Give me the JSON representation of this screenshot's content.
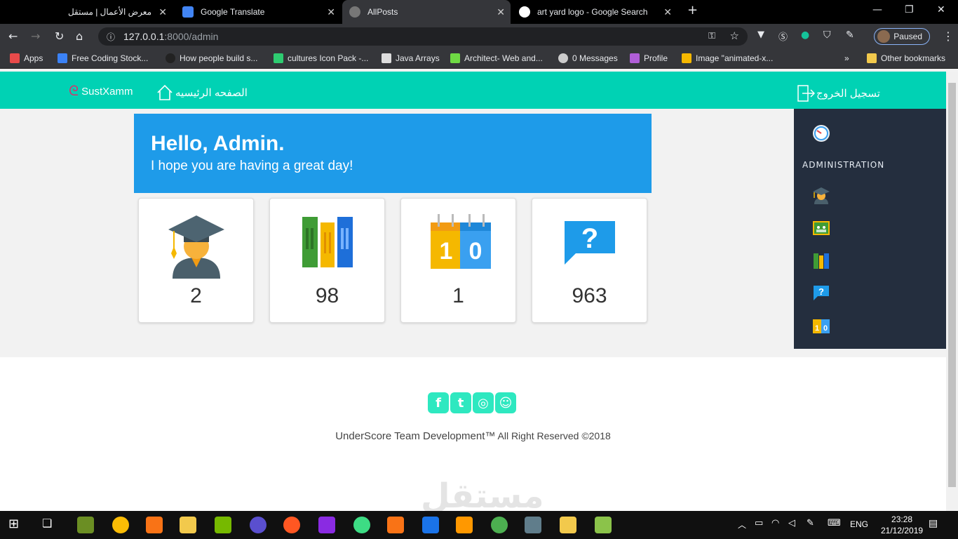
{
  "browser": {
    "tabs": [
      {
        "title": "معرض الأعمال | مستقل"
      },
      {
        "title": "Google Translate"
      },
      {
        "title": "AllPosts"
      },
      {
        "title": "art yard logo - Google Search"
      }
    ],
    "url_host": "127.0.0.1",
    "url_path": ":8000/admin",
    "profile_status": "Paused",
    "bookmarks": [
      "Apps",
      "Free Coding Stock...",
      "How people build s...",
      "cultures Icon Pack -...",
      "Java Arrays",
      "Architect- Web and...",
      "0 Messages",
      "Profile",
      "Image \"animated-x...",
      "Other bookmarks"
    ]
  },
  "navbar": {
    "brand": "SustXamm",
    "home": "الصفحه الرئيسيه",
    "logout": "تسجيل الخروج"
  },
  "sidebar": {
    "section_title": "ADMINISTRATION",
    "items": [
      "dashboard-icon",
      "graduate-icon",
      "classroom-icon",
      "books-icon",
      "question-icon",
      "calendar-icon"
    ]
  },
  "banner": {
    "title": "Hello, Admin.",
    "subtitle": "I hope you are having a great day!"
  },
  "stats": [
    {
      "icon": "graduate-icon",
      "value": "2"
    },
    {
      "icon": "books-icon",
      "value": "98"
    },
    {
      "icon": "calendar-icon",
      "value": "1"
    },
    {
      "icon": "question-icon",
      "value": "963"
    }
  ],
  "footer": {
    "company": "UnderScore Team Development™",
    "rights": "All Right Reserved ©2018",
    "socials": [
      "facebook-icon",
      "twitter-icon",
      "instagram-icon",
      "snapchat-icon"
    ]
  },
  "taskbar": {
    "language": "ENG",
    "time": "23:28",
    "date": "21/12/2019"
  },
  "colors": {
    "navbar": "#00d2b4",
    "banner": "#1e9be9",
    "sidebar": "#242e3e",
    "social": "#2ee8c0"
  }
}
